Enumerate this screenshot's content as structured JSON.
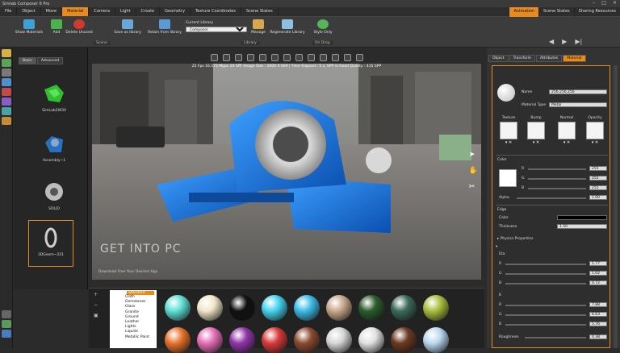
{
  "app": {
    "title": "Simlab Composer 6 Pro"
  },
  "window_controls": {
    "minimize": "–",
    "maximize": "□",
    "close": "×"
  },
  "menu_tabs": [
    {
      "label": "File"
    },
    {
      "label": "Object"
    },
    {
      "label": "Move"
    },
    {
      "label": "Material",
      "active": true
    },
    {
      "label": "Camera"
    },
    {
      "label": "Light"
    },
    {
      "label": "Create"
    },
    {
      "label": "Geometry"
    },
    {
      "label": "Texture Coordinates"
    },
    {
      "label": "Scene States"
    }
  ],
  "right_tabs": [
    {
      "label": "Animation",
      "active": true
    },
    {
      "label": "Scene States"
    },
    {
      "label": "Sharing Resources"
    }
  ],
  "ribbon": {
    "buttons": [
      {
        "label": "Show Materials",
        "color": "#3fa0d6"
      },
      {
        "label": "Add",
        "color": "#4bb24b"
      },
      {
        "label": "Delete Unused",
        "color": "#d23a2f"
      },
      {
        "label": "Save as library",
        "color": "#6aa7d8"
      },
      {
        "label": "Retain from library",
        "color": "#5b9bd5"
      },
      {
        "label": "Manage",
        "color": "#d9a650"
      },
      {
        "label": "Regenerate Library",
        "color": "#8fbfe0"
      },
      {
        "label": "Style Only",
        "color": "#59b359"
      }
    ],
    "current_library_label": "Current Library",
    "current_library_value": "Composer",
    "groups": {
      "scene": "Scene",
      "library": "Library",
      "on_drop": "On Drop"
    }
  },
  "animation": {
    "prev": "◀",
    "play": "▶",
    "next": "▶|"
  },
  "library_panel": {
    "tabs": [
      {
        "label": "Basic",
        "active": true
      },
      {
        "label": "Advanced"
      }
    ],
    "items": [
      {
        "label": "SimLab2W30",
        "color": "#2fbf2f"
      },
      {
        "label": "Assembly~1",
        "color": "#2a6fc0"
      },
      {
        "label": "SOLID",
        "color": "#bdbdbd"
      },
      {
        "label": "3DGeom~221",
        "color": "#cfcfcf"
      }
    ]
  },
  "viewport": {
    "status": "25 Fps   16.573 Mpps   24 SPF   Image Size : 1000 X 669 |  Time Elapsed : 5 s, SPP in Good Quality : 435 SPP",
    "watermark": "GET INTO PC",
    "watermark_sub": "Download Free Your Desired App",
    "right_icons": [
      "cursor-icon",
      "hand-icon",
      "tools-icon"
    ]
  },
  "material_tree": {
    "header": "Standard",
    "items": [
      "Cloth",
      "Gemstones",
      "Glass",
      "Granite",
      "Ground",
      "Leather",
      "Lights",
      "Liquids",
      "Metallic Paint"
    ]
  },
  "swatches": [
    [
      "#5fe0d6",
      "#f0e6c8",
      "#111111",
      "#46d2ee",
      "#3cbde8",
      "#c9a98c",
      "#2b5d2b",
      "#3a6b5a",
      "#a9bf3d"
    ],
    [
      "#e8732a",
      "#e56fb6",
      "#9135a8",
      "#d83a3a",
      "#8a4c2f",
      "#d6d6d6",
      "#e1e1e1",
      "#6a3a1f",
      "#bad9f0"
    ]
  ],
  "right_panel": {
    "tabs": [
      {
        "label": "Object"
      },
      {
        "label": "Transform"
      },
      {
        "label": "Attributes"
      },
      {
        "label": "Material",
        "active": true
      }
    ],
    "name_label": "Name",
    "name_value": "256.256.256",
    "material_type_label": "Material Type",
    "material_type_value": "Metal",
    "maps": [
      {
        "label": "Texture"
      },
      {
        "label": "Bump"
      },
      {
        "label": "Normal"
      },
      {
        "label": "Opacity"
      }
    ],
    "color_section": "Color",
    "rgb": [
      {
        "label": "R",
        "value": "255"
      },
      {
        "label": "G",
        "value": "255"
      },
      {
        "label": "B",
        "value": "255"
      }
    ],
    "alpha_label": "Alpha",
    "alpha_value": "1.00",
    "edge_section": "Edge",
    "edge_color_label": "Color",
    "thickness_label": "Thickness",
    "thickness_value": "1.50",
    "physics_label": "Physics Properties",
    "eta_label": "Eta",
    "eta": [
      {
        "label": "R",
        "value": "1.77"
      },
      {
        "label": "G",
        "value": "1.02"
      },
      {
        "label": "B",
        "value": "0.72"
      }
    ],
    "k_label": "K",
    "k": [
      {
        "label": "R",
        "value": "7.88"
      },
      {
        "label": "G",
        "value": "6.63"
      },
      {
        "label": "B",
        "value": "5.76"
      }
    ],
    "roughness_label": "Roughness",
    "roughness_value": "0.38"
  }
}
